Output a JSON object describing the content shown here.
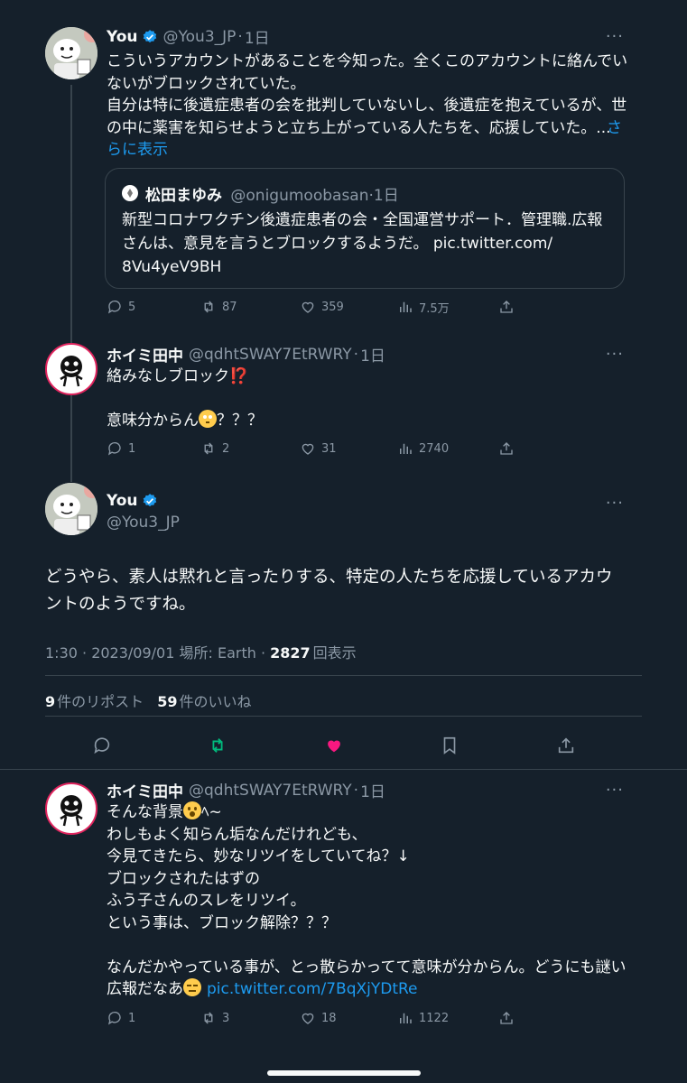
{
  "tweet1": {
    "name": "You",
    "handle": "@You3_JP",
    "time": "1日",
    "lines": [
      "こういうアカウントがあることを今知った。全くこのアカウントに絡んでい",
      "ないがブロックされていた。",
      "自分は特に後遺症患者の会を批判していないし、後遺症を抱えているが、世",
      "の中に薬害を知らせようと立ち上がっている人たちを、応援していた。..."
    ],
    "show_more_1": "さ",
    "show_more_2": "らに表示",
    "quote": {
      "name": "松田まゆみ",
      "handle": "@onigumoobasan",
      "time": "1日",
      "lines": [
        "新型コロナワクチン後遺症患者の会・全国運営サポート．管理職.広報",
        "さんは、意見を言うとブロックするようだ。 pic.twitter.com/",
        "8Vu4yeV9BH"
      ]
    },
    "replies": "5",
    "reposts": "87",
    "likes": "359",
    "views": "7.5万"
  },
  "tweet2": {
    "name": "ホイミ田中",
    "handle": "@qdhtSWAY7EtRWRY",
    "time": "1日",
    "line1": "絡みなしブロック",
    "line1_emoji": "⁉️",
    "line2": "意味分からん",
    "line2_tail": "？？？",
    "replies": "1",
    "reposts": "2",
    "likes": "31",
    "views": "2740"
  },
  "main": {
    "name": "You",
    "handle": "@You3_JP",
    "lines": [
      "どうやら、素人は黙れと言ったりする、特定の人たちを応援しているアカウ",
      "ントのようですね。"
    ],
    "meta_time": "1:30 · 2023/09/01 場所: Earth · ",
    "meta_views": "2827",
    "meta_views_label": "回表示",
    "reposts_count": "9",
    "reposts_label": "件のリポスト",
    "likes_count": "59",
    "likes_label": "件のいいね"
  },
  "tweet3": {
    "name": "ホイミ田中",
    "handle": "@qdhtSWAY7EtRWRY",
    "time": "1日",
    "line1": "そんな背景",
    "line1_tail": "ﾍ~",
    "lines": [
      "わしもよく知らん垢なんだけれども、",
      "今見てきたら、妙なリツイをしていてね？↓",
      "ブロックされたはずの",
      "ふう子さんのスレをリツイ。",
      "という事は、ブロック解除？？？"
    ],
    "line_last1": "なんだかやっている事が、とっ散らかってて意味が分からん。どうにも謎い",
    "line_last2": "広報だなあ",
    "link": "pic.twitter.com/7BqXjYDtRe",
    "replies": "1",
    "reposts": "3",
    "likes": "18",
    "views": "1122"
  },
  "more_label": "···",
  "colors": {
    "accent": "#1d9bf0",
    "like": "#f91880",
    "repost": "#00ba7c",
    "background": "#15202b"
  }
}
